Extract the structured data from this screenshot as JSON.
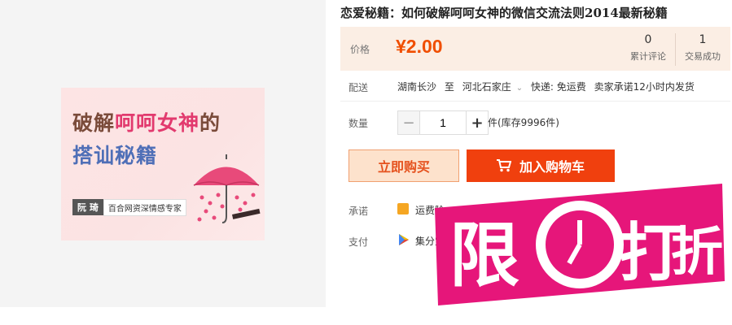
{
  "product": {
    "title": "恋爱秘籍：如何破解呵呵女神的微信交流法则2014最新秘籍",
    "image": {
      "line1_a": "破解",
      "line1_b": "呵呵女神",
      "line1_c": "的",
      "line2": "搭讪秘籍",
      "badge_name": "阮 琦",
      "badge_desc": "百合网资深情感专家"
    }
  },
  "price": {
    "label": "价格",
    "value": "¥2.00",
    "reviews_count": "0",
    "reviews_label": "累计评论",
    "trades_count": "1",
    "trades_label": "交易成功"
  },
  "shipping": {
    "label": "配送",
    "from": "湖南长沙",
    "to_word": "至",
    "to": "河北石家庄",
    "fee": "快递: 免运费",
    "promise": "卖家承诺12小时内发货"
  },
  "quantity": {
    "label": "数量",
    "value": "1",
    "stock": "件(库存9996件)"
  },
  "actions": {
    "buy_now": "立即购买",
    "add_cart": "加入购物车"
  },
  "promise": {
    "label": "承诺",
    "text": "运费险"
  },
  "payment": {
    "label": "支付",
    "text": "集分宝"
  },
  "sale_banner": {
    "char1": "限",
    "char2": "打",
    "char3": "折"
  },
  "colors": {
    "accent": "#f04e00",
    "cart_button": "#f0400e",
    "banner": "#e6167a"
  }
}
